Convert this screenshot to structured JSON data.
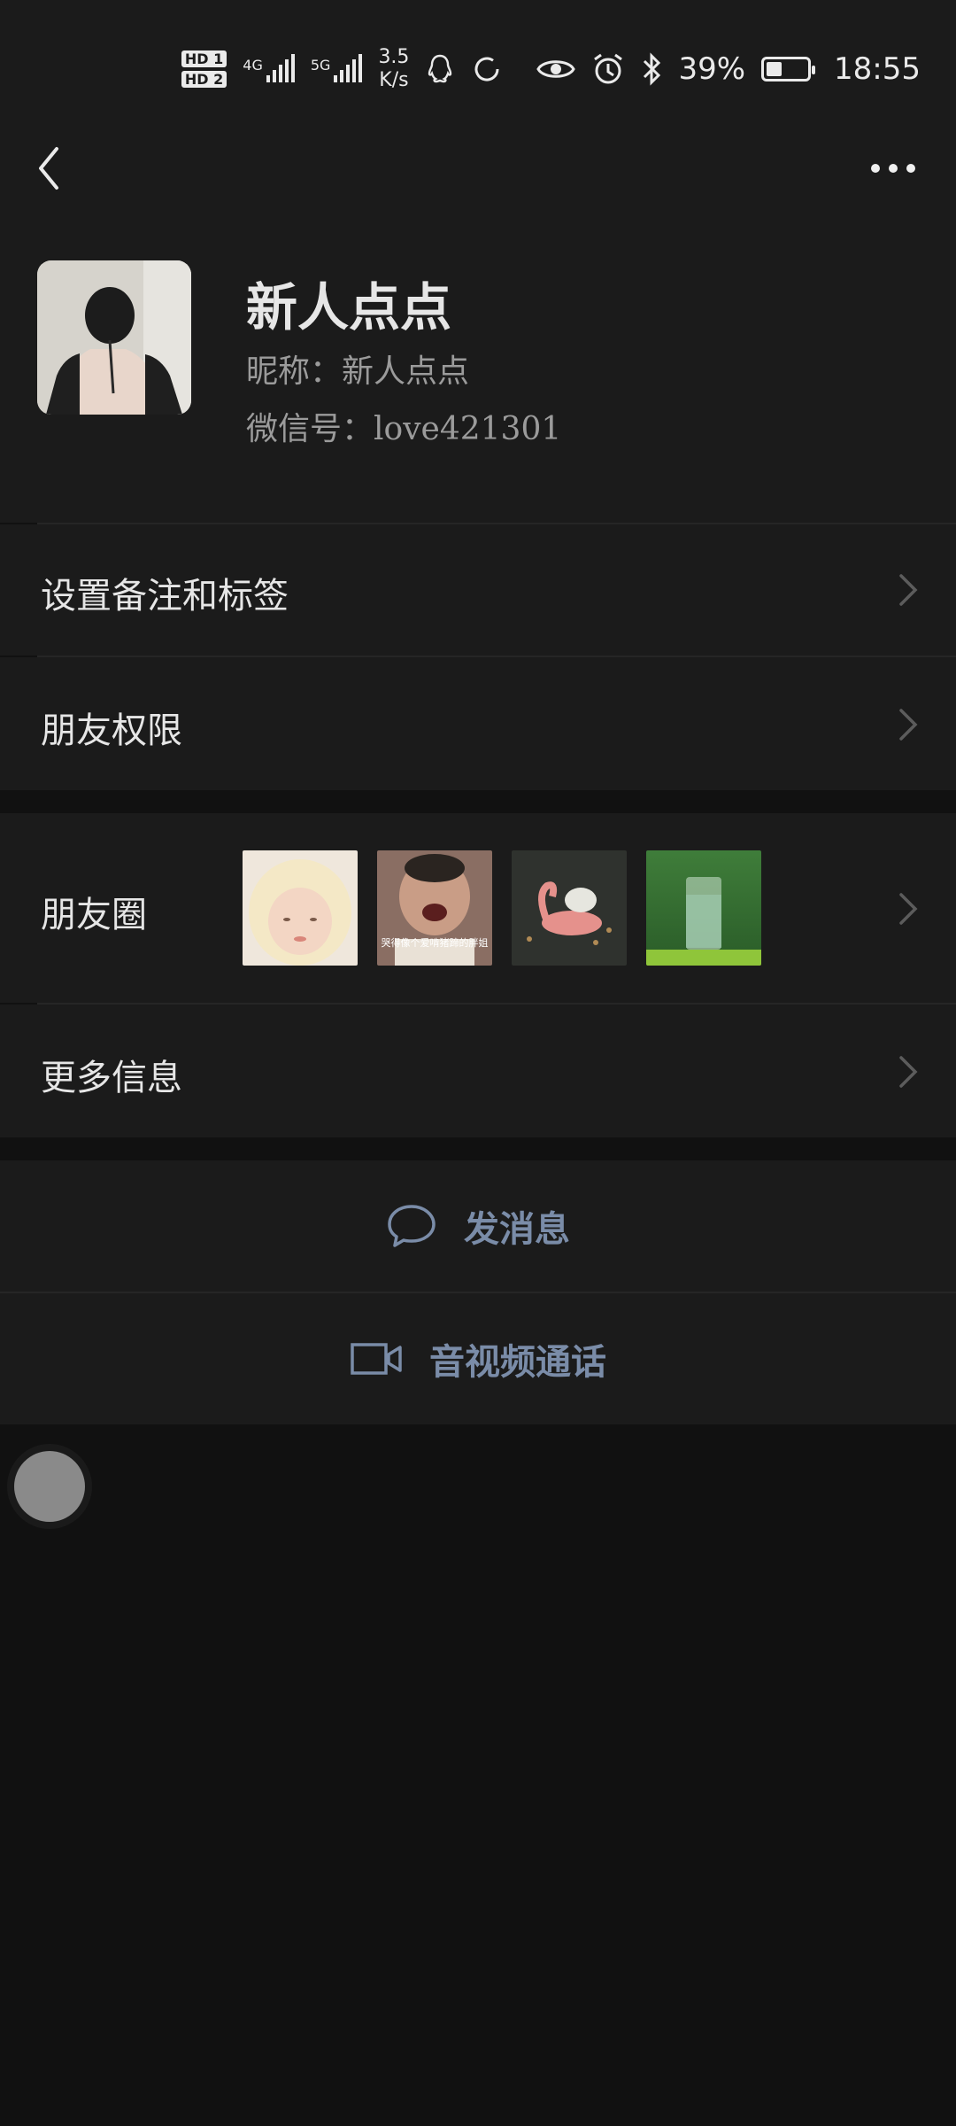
{
  "status_bar": {
    "hd1": "HD 1",
    "hd2": "HD 2",
    "net1": "4G",
    "net2": "5G",
    "speed_value": "3.5",
    "speed_unit": "K/s",
    "battery_percent": "39%",
    "battery_level": 0.39,
    "time": "18:55"
  },
  "profile": {
    "display_name": "新人点点",
    "nickname": "昵称：新人点点",
    "wechat_id": "微信号：love421301"
  },
  "menu": {
    "remark_tags": "设置备注和标签",
    "friend_permissions": "朋友权限",
    "moments": "朋友圈",
    "more_info": "更多信息"
  },
  "moments_thumbs": {
    "caption_2": "哭得像个爱啃猪蹄的胖姐"
  },
  "actions": {
    "send_message": "发消息",
    "video_call": "音视频通话"
  },
  "colors": {
    "background": "#111111",
    "panel": "#1b1b1b",
    "action_text": "#7a8ca8"
  }
}
